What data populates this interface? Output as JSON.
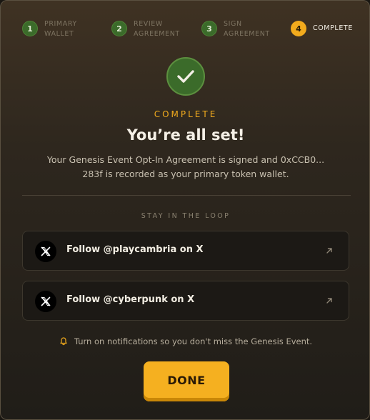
{
  "stepper": {
    "steps": [
      {
        "number": "1",
        "label_line1": "PRIMARY",
        "label_line2": "WALLET",
        "state": "done"
      },
      {
        "number": "2",
        "label_line1": "REVIEW",
        "label_line2": "AGREEMENT",
        "state": "done"
      },
      {
        "number": "3",
        "label_line1": "SIGN",
        "label_line2": "AGREEMENT",
        "state": "done"
      },
      {
        "number": "4",
        "label_line1": "COMPLETE",
        "label_line2": "",
        "state": "active"
      }
    ]
  },
  "status": {
    "icon": "check-icon",
    "label": "COMPLETE",
    "title": "You’re all set!",
    "description": "Your Genesis Event Opt-In Agreement is signed and 0xCCB0... 283f is recorded as your primary token wallet."
  },
  "social": {
    "section_label": "STAY IN THE LOOP",
    "links": [
      {
        "label": "Follow @playcambria on X",
        "icon": "x-logo-icon",
        "action_icon": "external-link-icon"
      },
      {
        "label": "Follow @cyberpunk on X",
        "icon": "x-logo-icon",
        "action_icon": "external-link-icon"
      }
    ]
  },
  "notice": {
    "icon": "bell-icon",
    "text": "Turn on notifications so you don't miss the Genesis Event."
  },
  "actions": {
    "done_label": "DONE"
  },
  "colors": {
    "accent": "#f2ab1d",
    "success": "#3b6b2a",
    "background": "#2e271e"
  }
}
